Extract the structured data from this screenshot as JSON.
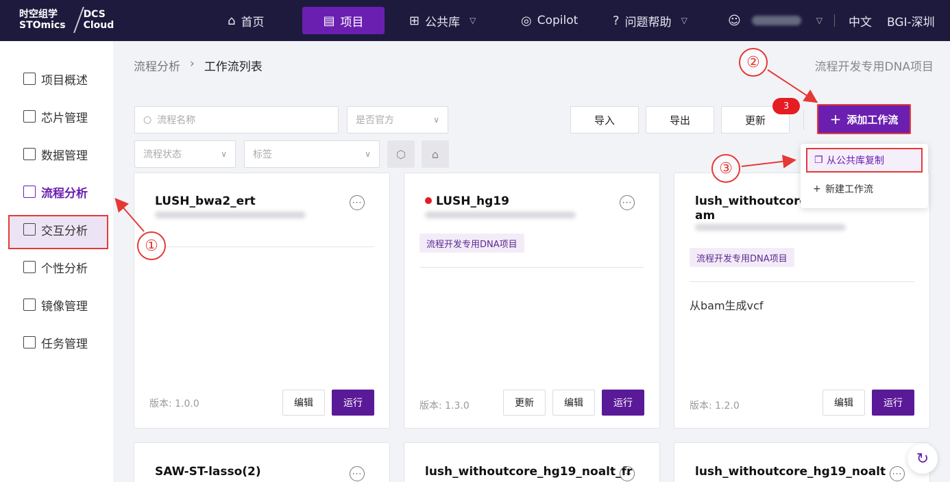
{
  "brand": {
    "cn": "时空组学",
    "en": "STOmics",
    "product1": "DCS",
    "product2": "Cloud"
  },
  "nav": {
    "home": "首页",
    "project": "项目",
    "library": "公共库",
    "copilot": "Copilot",
    "help": "问题帮助",
    "lang": "中文",
    "org": "BGI-深圳"
  },
  "sidebar": {
    "items": [
      "项目概述",
      "芯片管理",
      "数据管理",
      "流程分析",
      "交互分析",
      "个性分析",
      "镜像管理",
      "任务管理"
    ]
  },
  "breadcrumb": {
    "parent": "流程分析",
    "current": "工作流列表"
  },
  "project_name": "流程开发专用DNA项目",
  "filters": {
    "name_placeholder": "流程名称",
    "official_placeholder": "是否官方",
    "status_placeholder": "流程状态",
    "tag_placeholder": "标签"
  },
  "toolbar": {
    "import": "导入",
    "export": "导出",
    "update": "更新",
    "update_badge": "3",
    "add": "添加工作流"
  },
  "add_menu": {
    "copy_from_library": "从公共库复制",
    "new_workflow": "新建工作流"
  },
  "cards": [
    {
      "title": "LUSH_bwa2_ert",
      "version_label": "版本:",
      "version": "1.0.0",
      "edit": "编辑",
      "run": "运行"
    },
    {
      "title": "LUSH_hg19",
      "tag": "流程开发专用DNA项目",
      "version_label": "版本:",
      "version": "1.3.0",
      "update": "更新",
      "edit": "编辑",
      "run": "运行"
    },
    {
      "title": "lush_withoutcore_h",
      "title2": "am",
      "tag": "流程开发专用DNA项目",
      "desc": "从bam生成vcf",
      "version_label": "版本:",
      "version": "1.2.0",
      "edit": "编辑",
      "run": "运行"
    },
    {
      "title": "SAW-ST-lasso(2)"
    },
    {
      "title": "lush_withoutcore_hg19_noalt_fr"
    },
    {
      "title": "lush_withoutcore_hg19_noalt"
    }
  ],
  "annotations": [
    "①",
    "②",
    "③"
  ]
}
